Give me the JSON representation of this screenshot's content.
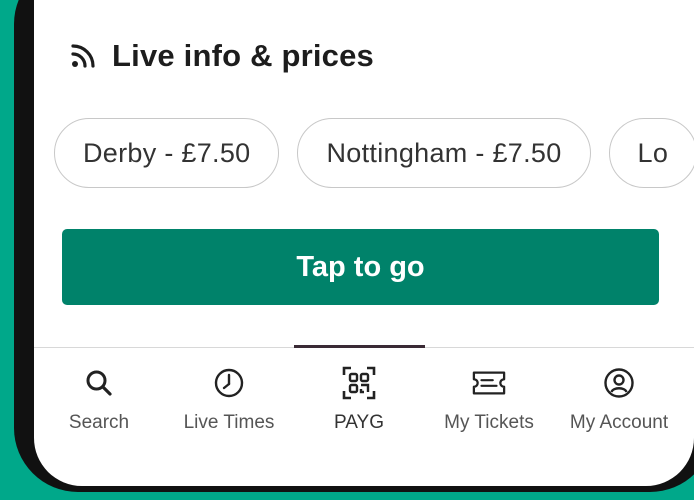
{
  "live_info": {
    "title": "Live info & prices",
    "icon": "live-signal-icon"
  },
  "price_chips": [
    {
      "label": "Derby - £7.50"
    },
    {
      "label": "Nottingham - £7.50"
    },
    {
      "label": "Lo"
    }
  ],
  "cta": {
    "label": "Tap to go"
  },
  "tabs": [
    {
      "label": "Search",
      "icon": "search-icon"
    },
    {
      "label": "Live Times",
      "icon": "clock-icon"
    },
    {
      "label": "PAYG",
      "icon": "qr-code-icon",
      "active": true
    },
    {
      "label": "My Tickets",
      "icon": "ticket-icon"
    },
    {
      "label": "My Account",
      "icon": "account-icon"
    }
  ],
  "colors": {
    "background": "#00a88a",
    "primary": "#00826a",
    "active_indicator": "#3a2a35"
  }
}
